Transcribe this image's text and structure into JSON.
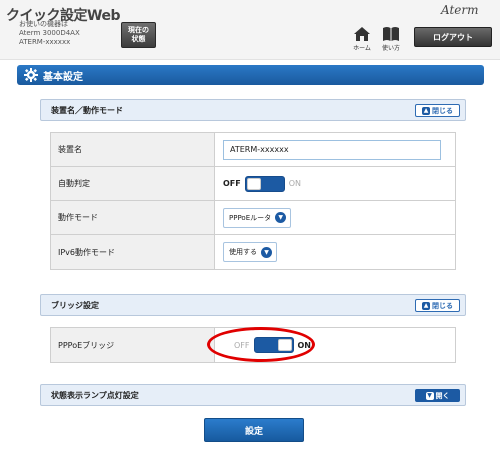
{
  "header": {
    "app_title": "クイック設定Web",
    "device_caption": "お使いの機器は",
    "device_model": "Aterm 3000D4AX",
    "device_name": "ATERM-xxxxxx",
    "status_button": "現在の\n状態",
    "brand": "Aterm",
    "home_label": "ホーム",
    "guide_label": "使い方",
    "logout_label": "ログアウト"
  },
  "section": {
    "title": "基本設定"
  },
  "panel_device": {
    "title": "装置名／動作モード",
    "toggle_label": "閉じる",
    "rows": [
      {
        "label": "装置名",
        "value": "ATERM-xxxxxx"
      },
      {
        "label": "自動判定",
        "off": "OFF",
        "on": "ON",
        "state": "OFF"
      },
      {
        "label": "動作モード",
        "value": "PPPoEルータ"
      },
      {
        "label": "IPv6動作モード",
        "value": "使用する"
      }
    ]
  },
  "panel_bridge": {
    "title": "ブリッジ設定",
    "toggle_label": "閉じる",
    "rows": [
      {
        "label": "PPPoEブリッジ",
        "off": "OFF",
        "on": "ON",
        "state": "ON"
      }
    ]
  },
  "panel_lamp": {
    "title": "状態表示ランプ点灯設定",
    "toggle_label": "開く"
  },
  "submit_label": "設定",
  "colors": {
    "accent": "#1c5aa3",
    "highlight": "#e00000"
  }
}
